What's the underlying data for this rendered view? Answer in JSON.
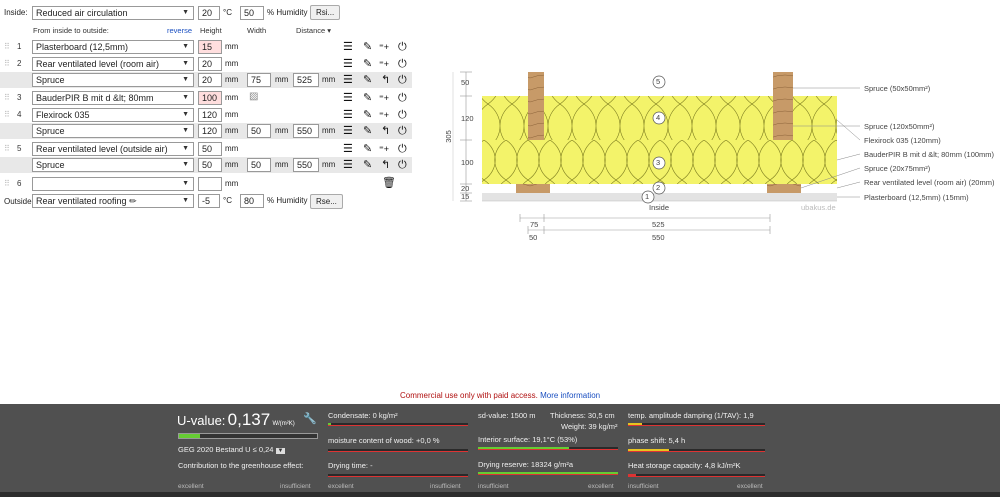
{
  "inside": {
    "label": "Inside:",
    "climate": "Reduced air circulation",
    "temp": "20",
    "temp_unit": "°C",
    "humidity": "50",
    "humidity_unit": "% Humidity",
    "rsi_button": "Rsi..."
  },
  "headers": {
    "from_inside": "From inside to outside:",
    "reverse": "reverse",
    "height": "Height",
    "width": "Width",
    "distance": "Distance ▾"
  },
  "rows": [
    {
      "index": "1",
      "material": "Plasterboard (12,5mm)",
      "height": "15",
      "unit": "mm"
    },
    {
      "index": "2",
      "material": "Rear ventilated level (room air)",
      "height": "20",
      "unit": "mm"
    },
    {
      "material": "Spruce",
      "height": "20",
      "unit": "mm",
      "width": "75",
      "width_unit": "mm",
      "distance": "525",
      "distance_unit": "mm"
    },
    {
      "index": "3",
      "material": "BauderPIR B mit d &lt; 80mm",
      "height": "100",
      "unit": "mm"
    },
    {
      "index": "4",
      "material": "Flexirock 035",
      "height": "120",
      "unit": "mm"
    },
    {
      "material": "Spruce",
      "height": "120",
      "unit": "mm",
      "width": "50",
      "width_unit": "mm",
      "distance": "550",
      "distance_unit": "mm"
    },
    {
      "index": "5",
      "material": "Rear ventilated level (outside air)",
      "height": "50",
      "unit": "mm"
    },
    {
      "material": "Spruce",
      "height": "50",
      "unit": "mm",
      "width": "50",
      "width_unit": "mm",
      "distance": "550",
      "distance_unit": "mm"
    },
    {
      "index": "6",
      "material": "",
      "height": "",
      "unit": "mm"
    }
  ],
  "outside": {
    "label": "Outside",
    "climate": "Rear ventilated roofing",
    "temp": "-5",
    "temp_unit": "°C",
    "humidity": "80",
    "humidity_unit": "% Humidity",
    "rse_button": "Rse..."
  },
  "diagram": {
    "inside_label": "Inside",
    "watermark": "ubakus.de",
    "thickness_label": "305",
    "left_ticks": [
      "50",
      "120",
      "100",
      "20",
      "15"
    ],
    "bottom_dims": [
      "75",
      "525",
      "50",
      "550"
    ],
    "circle_numbers": [
      "1",
      "2",
      "3",
      "4",
      "5"
    ],
    "legend": [
      "Spruce (50x50mm²)",
      "Spruce (120x50mm²)",
      "Flexirock 035 (120mm)",
      "BauderPIR B mit d &lt; 80mm (100mm)",
      "Spruce (20x75mm²)",
      "Rear ventilated level (room air) (20mm)",
      "Plasterboard (12,5mm) (15mm)"
    ]
  },
  "notice": {
    "text": "Commercial use only with paid access.",
    "link": "More information"
  },
  "results": {
    "uvalue_label": "U-value:",
    "uvalue": "0,137",
    "uvalue_unit": "W/(m²K)",
    "geg": "GEG 2020 Bestand U ≤ 0,24",
    "greenhouse": "Contribution to the greenhouse effect:",
    "condensate": "Condensate: 0 kg/m²",
    "moisture": "moisture content of wood: +0,0 %",
    "drying_time": "Drying time: -",
    "sd": "sd-value: 1500 m",
    "thickness": "Thickness: 30,5 cm",
    "weight": "Weight: 39 kg/m²",
    "surface": "Interior surface: 19,1°C (53%)",
    "reserve": "Drying reserve: 18324 g/m²a",
    "tav": "temp. amplitude damping (1/TAV): 1,9",
    "phase": "phase shift: 5,4 h",
    "heat": "Heat storage capacity: 4,8 kJ/m²K",
    "excellent": "excellent",
    "insufficient": "insufficient"
  },
  "colors": {
    "insulation": "#f3f36a",
    "wood": "#c79a68",
    "footer": "#505050",
    "green": "#6c3",
    "yellow": "#e7c31f",
    "red": "#d33"
  }
}
